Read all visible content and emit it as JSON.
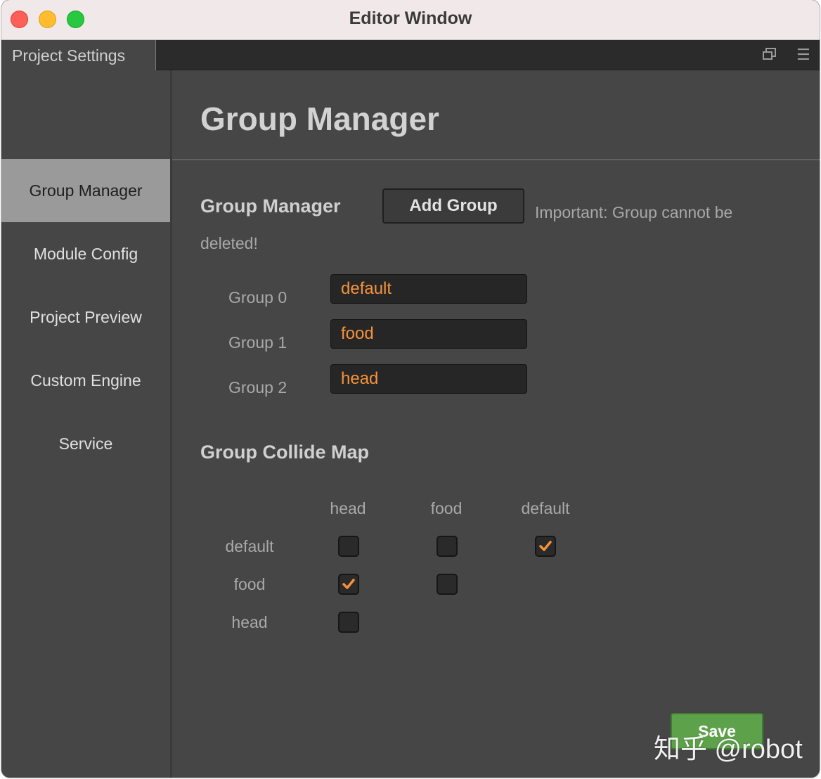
{
  "window": {
    "title": "Editor Window"
  },
  "tab": {
    "label": "Project Settings",
    "popout_icon": "popout-icon",
    "menu_icon": "menu-icon"
  },
  "sidebar": {
    "items": [
      {
        "label": "Group Manager",
        "active": true
      },
      {
        "label": "Module Config",
        "active": false
      },
      {
        "label": "Project Preview",
        "active": false
      },
      {
        "label": "Custom Engine",
        "active": false
      },
      {
        "label": "Service",
        "active": false
      }
    ]
  },
  "main": {
    "page_title": "Group Manager",
    "group_section_title": "Group Manager",
    "add_group_label": "Add Group",
    "important_text": "Important: Group cannot be deleted!",
    "groups": [
      {
        "label": "Group 0",
        "value": "default"
      },
      {
        "label": "Group 1",
        "value": "food"
      },
      {
        "label": "Group 2",
        "value": "head"
      }
    ],
    "collide_title": "Group Collide Map",
    "collide": {
      "columns": [
        "head",
        "food",
        "default"
      ],
      "rows": [
        {
          "label": "default",
          "checks": [
            false,
            false,
            true
          ]
        },
        {
          "label": "food",
          "checks": [
            true,
            false
          ]
        },
        {
          "label": "head",
          "checks": [
            false
          ]
        }
      ]
    },
    "save_label": "Save"
  },
  "watermark": "知乎 @robot",
  "colors": {
    "accent": "#f5923a",
    "save": "#5ea14b",
    "active_item": "#9a9a9a"
  }
}
